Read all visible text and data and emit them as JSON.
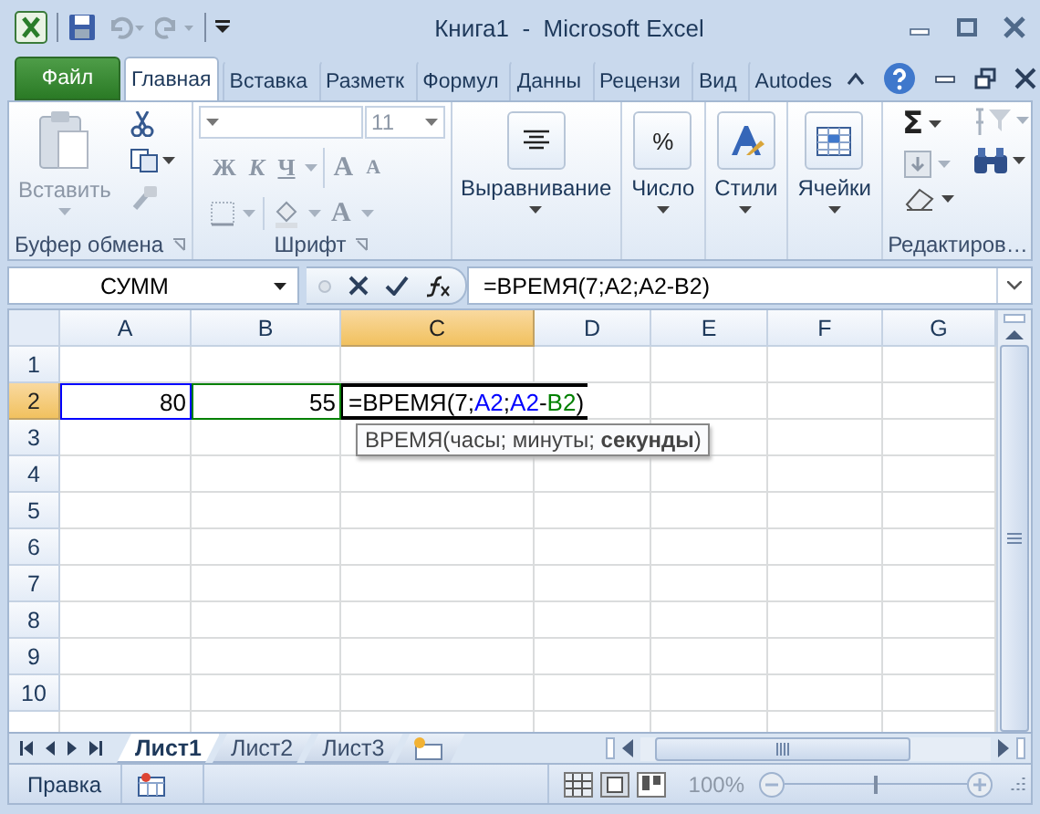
{
  "window": {
    "title": "Книга1  -  Microsoft Excel"
  },
  "ribbon_tabs": [
    {
      "label": "Файл",
      "kind": "file",
      "selected": false
    },
    {
      "label": "Главная",
      "kind": "tab",
      "selected": true
    },
    {
      "label": "Вставка",
      "kind": "tab",
      "selected": false
    },
    {
      "label": "Разметк",
      "kind": "tab",
      "selected": false
    },
    {
      "label": "Формул",
      "kind": "tab",
      "selected": false
    },
    {
      "label": "Данны",
      "kind": "tab",
      "selected": false
    },
    {
      "label": "Рецензи",
      "kind": "tab",
      "selected": false
    },
    {
      "label": "Вид",
      "kind": "tab",
      "selected": false
    },
    {
      "label": "Autodes",
      "kind": "tab",
      "selected": false
    }
  ],
  "ribbon": {
    "clipboard": {
      "label": "Буфер обмена",
      "paste": "Вставить"
    },
    "font": {
      "label": "Шрифт",
      "size": "11",
      "style_buttons": [
        "Ж",
        "К",
        "Ч"
      ],
      "grow": "A",
      "shrink": "A",
      "font_color_glyph": "A"
    },
    "big_buttons": [
      {
        "label": "Выравнивание",
        "kind": "align"
      },
      {
        "label": "Число",
        "kind": "number",
        "glyph": "%"
      },
      {
        "label": "Стили",
        "kind": "styles"
      },
      {
        "label": "Ячейки",
        "kind": "cells"
      }
    ],
    "editing": {
      "label": "Редактиров…",
      "sum": "Σ"
    }
  },
  "formula_bar": {
    "name_box": "СУММ",
    "formula": "=ВРЕМЯ(7;A2;A2-B2)"
  },
  "grid": {
    "columns": [
      {
        "label": "A",
        "selected": false
      },
      {
        "label": "B",
        "selected": false
      },
      {
        "label": "C",
        "selected": true
      },
      {
        "label": "D",
        "selected": false
      },
      {
        "label": "E",
        "selected": false
      },
      {
        "label": "F",
        "selected": false
      },
      {
        "label": "G",
        "selected": false
      }
    ],
    "rows": [
      {
        "number": "1",
        "selected": false
      },
      {
        "number": "2",
        "selected": true,
        "cells": [
          {
            "kind": "value",
            "value": "80",
            "color": "#0000ff"
          },
          {
            "kind": "value",
            "value": "55",
            "color": "#008000"
          },
          {
            "kind": "editing",
            "parts": [
              {
                "text": "=ВРЕМЯ(7;",
                "color": "#000000"
              },
              {
                "text": "A2",
                "color": "#0000ff"
              },
              {
                "text": ";",
                "color": "#000000"
              },
              {
                "text": "A2",
                "color": "#0000ff"
              },
              {
                "text": "-",
                "color": "#000000"
              },
              {
                "text": "B2",
                "color": "#008000"
              },
              {
                "text": ")",
                "color": "#000000"
              }
            ]
          }
        ]
      },
      {
        "number": "3",
        "selected": false
      },
      {
        "number": "4",
        "selected": false
      },
      {
        "number": "5",
        "selected": false
      },
      {
        "number": "6",
        "selected": false
      },
      {
        "number": "7",
        "selected": false
      },
      {
        "number": "8",
        "selected": false
      },
      {
        "number": "9",
        "selected": false
      },
      {
        "number": "10",
        "selected": false
      }
    ],
    "tooltip": "ВРЕМЯ(часы; минуты; **секунды**)"
  },
  "sheet_tabs": [
    {
      "label": "Лист1",
      "selected": true
    },
    {
      "label": "Лист2",
      "selected": false
    },
    {
      "label": "Лист3",
      "selected": false
    }
  ],
  "status_bar": {
    "mode": "Правка",
    "zoom": "100%",
    "zoom_slider": {
      "level": 0.5
    }
  }
}
